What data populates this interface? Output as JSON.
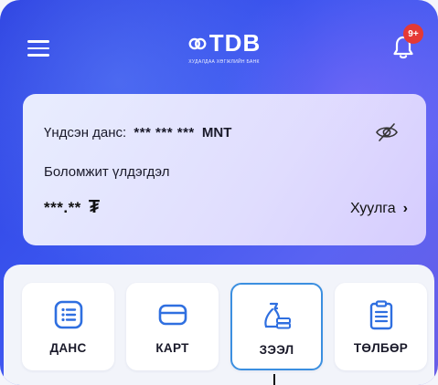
{
  "header": {
    "logo_text": "TDB",
    "logo_subtitle": "ХУДАЛДАА ХӨГЖЛИЙН БАНК",
    "notification_badge": "9+"
  },
  "card": {
    "account_label": "Үндсэн данс:",
    "account_mask": "*** *** ***",
    "currency": "MNT",
    "available_label": "Боломжит үлдэгдэл",
    "available_mask": "***.**",
    "currency_symbol": "₮",
    "history_label": "Хуулга"
  },
  "quick_actions": [
    {
      "label": "ДАНС",
      "icon": "list-icon"
    },
    {
      "label": "КАРТ",
      "icon": "card-icon"
    },
    {
      "label": "ЗЭЭЛ",
      "icon": "loan-bag-icon",
      "selected": true
    },
    {
      "label": "ТӨЛБӨР",
      "icon": "clipboard-icon"
    }
  ],
  "colors": {
    "primary": "#3b55ef",
    "icon_blue": "#2f6fe0",
    "badge_red": "#e53935",
    "highlight_border": "#3b8fe0"
  }
}
